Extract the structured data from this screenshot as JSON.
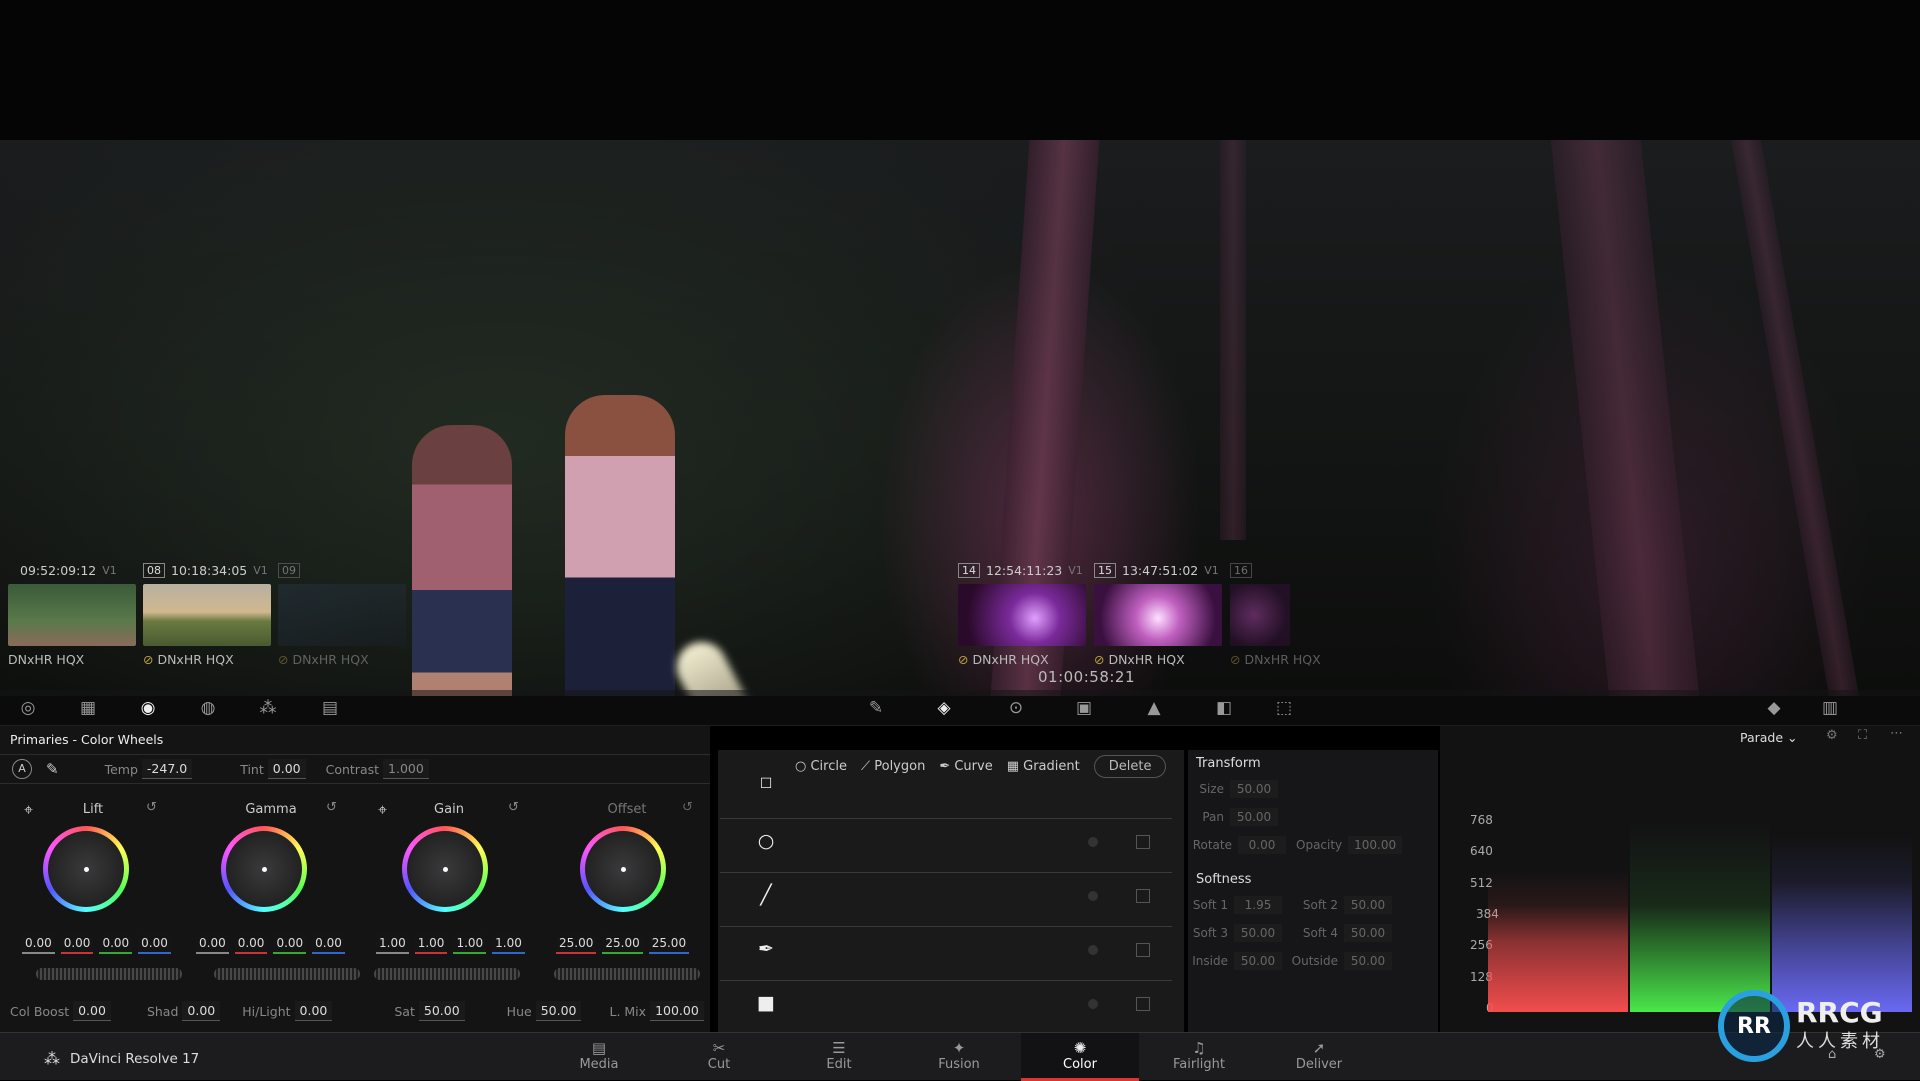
{
  "viewer": {
    "timecode": "01:00:58:21"
  },
  "clips": [
    {
      "id": "clip-07",
      "num": "",
      "tc": "09:52:09:12",
      "track": "V1",
      "codec": "DNxHR HQX",
      "dim": false
    },
    {
      "id": "clip-08",
      "num": "08",
      "tc": "10:18:34:05",
      "track": "V1",
      "codec": "DNxHR HQX",
      "dim": false
    },
    {
      "id": "clip-09",
      "num": "09",
      "tc": "",
      "track": "",
      "codec": "DNxHR HQX",
      "dim": true
    },
    {
      "id": "clip-14",
      "num": "14",
      "tc": "12:54:11:23",
      "track": "V1",
      "codec": "DNxHR HQX",
      "dim": false
    },
    {
      "id": "clip-15",
      "num": "15",
      "tc": "13:47:51:02",
      "track": "V1",
      "codec": "DNxHR HQX",
      "dim": false
    },
    {
      "id": "clip-16",
      "num": "16",
      "tc": "",
      "track": "",
      "codec": "DNxHR HQX",
      "dim": true
    }
  ],
  "primaries": {
    "title": "Primaries - Color Wheels",
    "temp_label": "Temp",
    "temp_value": "-247.0",
    "tint_label": "Tint",
    "tint_value": "0.00",
    "contrast_label": "Contrast",
    "contrast_value": "1.000",
    "wheels": [
      {
        "name": "Lift",
        "values": [
          "0.00",
          "0.00",
          "0.00",
          "0.00"
        ]
      },
      {
        "name": "Gamma",
        "values": [
          "0.00",
          "0.00",
          "0.00",
          "0.00"
        ]
      },
      {
        "name": "Gain",
        "values": [
          "1.00",
          "1.00",
          "1.00",
          "1.00"
        ]
      },
      {
        "name": "Offset",
        "values": [
          "25.00",
          "25.00",
          "25.00"
        ]
      }
    ],
    "bottom": {
      "col_boost_label": "Col Boost",
      "col_boost": "0.00",
      "shad_label": "Shad",
      "shad": "0.00",
      "hilight_label": "Hi/Light",
      "hilight": "0.00",
      "sat_label": "Sat",
      "sat": "50.00",
      "hue_label": "Hue",
      "hue": "50.00",
      "lmix_label": "L. Mix",
      "lmix": "100.00"
    }
  },
  "shapes": {
    "circle": "Circle",
    "polygon": "Polygon",
    "curve": "Curve",
    "gradient": "Gradient",
    "delete": "Delete"
  },
  "transform": {
    "title": "Transform",
    "size_label": "Size",
    "size": "50.00",
    "pan_label": "Pan",
    "pan": "50.00",
    "rotate_label": "Rotate",
    "rotate": "0.00",
    "opacity_label": "Opacity",
    "opacity": "100.00",
    "softness_title": "Softness",
    "soft1_label": "Soft 1",
    "soft1": "1.95",
    "soft2_label": "Soft 2",
    "soft2": "50.00",
    "soft3_label": "Soft 3",
    "soft3": "50.00",
    "soft4_label": "Soft 4",
    "soft4": "50.00",
    "inside_label": "Inside",
    "inside": "50.00",
    "outside_label": "Outside",
    "outside": "50.00"
  },
  "scope": {
    "mode": "Parade",
    "ticks": [
      "768",
      "640",
      "512",
      "384",
      "256",
      "128",
      "0"
    ]
  },
  "app": {
    "name": "DaVinci Resolve 17"
  },
  "pages": [
    {
      "label": "Media",
      "icon": "▤"
    },
    {
      "label": "Cut",
      "icon": "✂"
    },
    {
      "label": "Edit",
      "icon": "☰"
    },
    {
      "label": "Fusion",
      "icon": "✦"
    },
    {
      "label": "Color",
      "icon": "✺"
    },
    {
      "label": "Fairlight",
      "icon": "♫"
    },
    {
      "label": "Deliver",
      "icon": "➚"
    }
  ],
  "watermark": {
    "logo": "RR",
    "text": "RRCG",
    "sub": "人人素材"
  }
}
